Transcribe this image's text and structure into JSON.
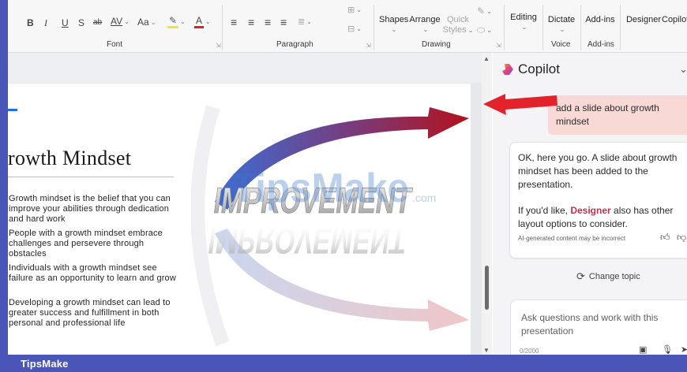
{
  "ribbon": {
    "font_buttons": {
      "bold": "B",
      "italic": "I",
      "underline": "U",
      "shadow": "S",
      "strikethrough": "ab",
      "char_spacing": "AV",
      "change_case": "Aa",
      "highlight": "A",
      "font_color": "A"
    },
    "groups": {
      "font": "Font",
      "paragraph": "Paragraph",
      "drawing": "Drawing",
      "voice": "Voice",
      "addins": "Add-ins"
    },
    "drawing": {
      "shapes": "Shapes",
      "arrange": "Arrange",
      "quick_styles": "Quick Styles"
    },
    "editing": "Editing",
    "dictate": "Dictate",
    "add_ins": "Add-ins",
    "designer": "Designer",
    "copilot": "Copilot"
  },
  "slide": {
    "title": "rowth Mindset",
    "bullets": [
      "Growth mindset is the belief that you can improve your abilities through dedication and hard work",
      "People with a growth mindset embrace challenges and persevere through obstacles",
      "Individuals with a growth mindset see failure as an opportunity to learn and grow",
      "Developing a growth mindset can lead to greater success and fulfillment in both personal and professional life"
    ],
    "image_text": "IMPROVEMENT",
    "watermark": "TipsMake",
    "watermark_suffix": ".com"
  },
  "copilot": {
    "title": "Copilot",
    "user_message": "add a slide about growth mindset",
    "reply_p1": "OK, here you go. A slide about growth mindset has been added to the presentation.",
    "reply_p2_before": "If you'd like, ",
    "reply_p2_link": "Designer",
    "reply_p2_after": " also has other layout options to consider.",
    "disclaimer": "AI-generated content may be incorrect",
    "change_topic": "Change topic",
    "input_placeholder": "Ask questions and work with this presentation",
    "char_count": "0/2000"
  },
  "footer": {
    "brand": "TipsMake"
  },
  "colors": {
    "frame": "#4a55b8",
    "annotation_arrow": "#e3232c",
    "user_bubble": "#f8d9d6",
    "designer_link": "#c4314b"
  }
}
